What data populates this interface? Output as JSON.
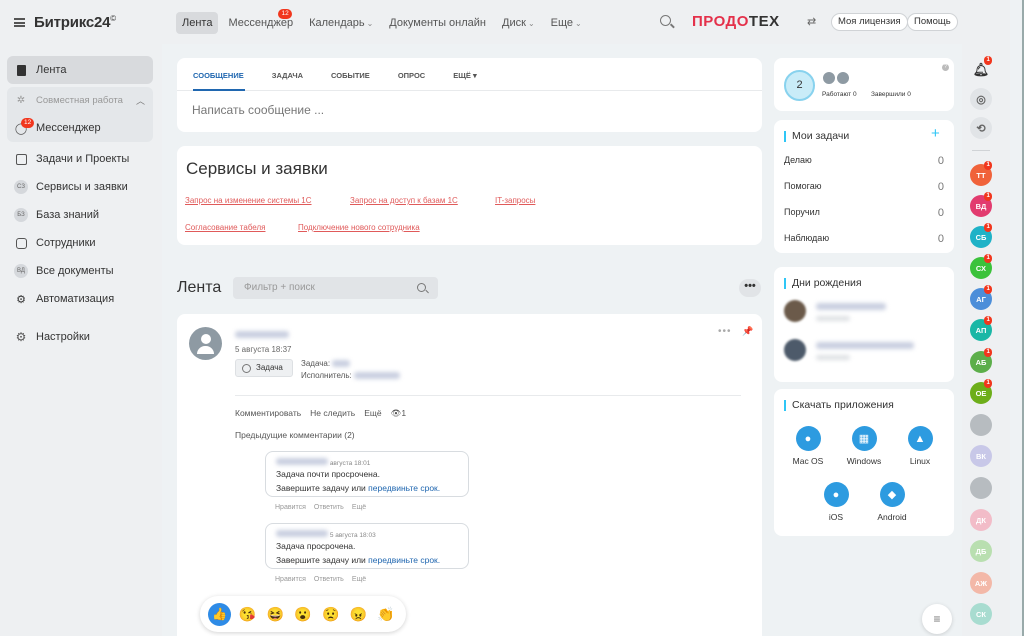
{
  "app": {
    "logo": "Битрикс24",
    "logo_mark": "©"
  },
  "sidebar": {
    "items": [
      {
        "label": "Лента",
        "icon": "feed-icon",
        "active": true
      },
      {
        "label": "Совместная работа",
        "icon": "collab-icon"
      },
      {
        "label": "Мессенджер",
        "icon": "messenger-icon",
        "badge": "12"
      },
      {
        "label": "Задачи и Проекты",
        "icon": "tasks-icon"
      },
      {
        "label": "Сервисы и заявки",
        "icon": "services-icon",
        "abbr": "СЗ"
      },
      {
        "label": "База знаний",
        "icon": "knowledge-icon",
        "abbr": "БЗ"
      },
      {
        "label": "Сотрудники",
        "icon": "employees-icon"
      },
      {
        "label": "Все документы",
        "icon": "documents-icon",
        "abbr": "ВД"
      },
      {
        "label": "Автоматизация",
        "icon": "automation-icon"
      },
      {
        "label": "Настройки",
        "icon": "gear-icon"
      }
    ]
  },
  "topbar": {
    "tabs": [
      {
        "label": "Лента",
        "active": true
      },
      {
        "label": "Мессенджер",
        "badge": "12"
      },
      {
        "label": "Календарь",
        "dropdown": true
      },
      {
        "label": "Документы онлайн"
      },
      {
        "label": "Диск",
        "dropdown": true
      },
      {
        "label": "Еще",
        "dropdown": true
      }
    ],
    "brand_red": "ПРОДО",
    "brand_dark": "ТЕХ",
    "license": "Моя лицензия",
    "help": "Помощь"
  },
  "post_form": {
    "tabs": [
      "СООБЩЕНИЕ",
      "ЗАДАЧА",
      "СОБЫТИЕ",
      "ОПРОС",
      "ЕЩЁ"
    ],
    "placeholder": "Написать сообщение ..."
  },
  "services": {
    "title": "Сервисы и заявки",
    "links": [
      "Запрос на изменение системы 1С",
      "Запрос на доступ к базам 1С",
      "IT-запросы",
      "Согласование табеля",
      "Подключение нового сотрудника"
    ]
  },
  "feed": {
    "title": "Лента",
    "filter_placeholder": "Фильтр + поиск",
    "more": "•••"
  },
  "post": {
    "date": "5 августа 18:37",
    "chip": "Задача",
    "task_label": "Задача:",
    "executor_label": "Исполнитель:",
    "actions": [
      "Комментировать",
      "Не следить",
      "Ещё",
      "1"
    ],
    "prev_comments": "Предыдущие комментарии (2)",
    "comments": [
      {
        "time": "авгуcта 18:01",
        "line1": "Задача почти просрочена.",
        "line2": "Завершите задачу или ",
        "link": "передвиньте срок.",
        "actions": [
          "Нравится",
          "Ответить",
          "Ещё"
        ]
      },
      {
        "time": "5 августа 18:03",
        "line1": "Задача просрочена.",
        "line2": "Завершите задачу или ",
        "link": "передвиньте срок.",
        "actions": [
          "Нравится",
          "Ответить",
          "Ещё"
        ]
      }
    ]
  },
  "stats": {
    "count": "2",
    "working": "Работают",
    "working_n": "0",
    "finished": "Завершили",
    "finished_n": "0",
    "help": "?"
  },
  "my_tasks": {
    "title": "Мои задачи",
    "plus": "+",
    "rows": [
      {
        "label": "Делаю",
        "value": "0"
      },
      {
        "label": "Помогаю",
        "value": "0"
      },
      {
        "label": "Поручил",
        "value": "0"
      },
      {
        "label": "Наблюдаю",
        "value": "0"
      }
    ]
  },
  "birthdays": {
    "title": "Дни рождения"
  },
  "apps": {
    "title": "Скачать приложения",
    "items": [
      {
        "label": "Mac OS",
        "icon": "apple-icon"
      },
      {
        "label": "Windows",
        "icon": "windows-icon"
      },
      {
        "label": "Linux",
        "icon": "linux-icon"
      },
      {
        "label": "iOS",
        "icon": "apple-icon"
      },
      {
        "label": "Android",
        "icon": "android-icon"
      }
    ]
  },
  "rail": {
    "notif_badge": "1",
    "users": [
      {
        "abbr": "ТТ",
        "color": "#f0623a",
        "badge": "1"
      },
      {
        "abbr": "ВД",
        "color": "#e23b6f",
        "badge": "1"
      },
      {
        "abbr": "СБ",
        "color": "#1fb2c7",
        "badge": "1"
      },
      {
        "abbr": "СХ",
        "color": "#3bc23b",
        "badge": "1"
      },
      {
        "abbr": "АГ",
        "color": "#4c8ed9",
        "badge": "1"
      },
      {
        "abbr": "АП",
        "color": "#1ab7a6",
        "badge": "1"
      },
      {
        "abbr": "АБ",
        "color": "#5cae4a",
        "badge": "1"
      },
      {
        "abbr": "ОЕ",
        "color": "#6dae1a",
        "badge": "1"
      },
      {
        "abbr": "",
        "color": "#b7bcc0"
      },
      {
        "abbr": "ВК",
        "color": "#c8c8e8"
      },
      {
        "abbr": "",
        "color": "#b7bcc0"
      },
      {
        "abbr": "ДК",
        "color": "#f2bcc8"
      },
      {
        "abbr": "ДБ",
        "color": "#b9dfb0"
      },
      {
        "abbr": "АЖ",
        "color": "#f3b8a8"
      },
      {
        "abbr": "СК",
        "color": "#a8dcd0"
      }
    ]
  }
}
